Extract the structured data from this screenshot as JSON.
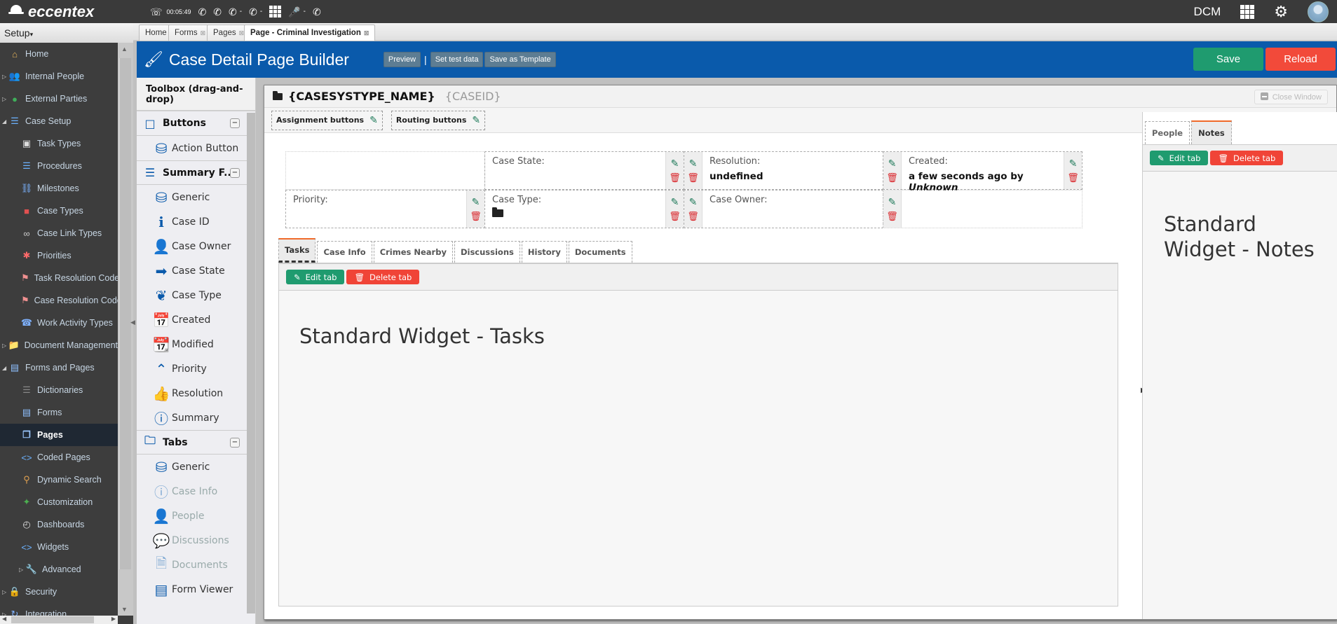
{
  "topbar": {
    "brand": "eccentex",
    "call_timer": "00:05:49",
    "icons": [
      "phone-icon",
      "phone-hangup-icon",
      "phone-hold-icon",
      "phone-transfer-icon",
      "phone-forward-icon",
      "dialpad-icon",
      "microphone-icon",
      "phone-info-icon"
    ],
    "user_label": "DCM"
  },
  "nav": {
    "setup_label": "Setup",
    "items": [
      {
        "label": "Home",
        "level": 1,
        "icon": "home-icon",
        "expand": ""
      },
      {
        "label": "Internal People",
        "level": 1,
        "icon": "people-icon",
        "expand": "collapsed"
      },
      {
        "label": "External Parties",
        "level": 1,
        "icon": "globe-icon",
        "expand": "collapsed"
      },
      {
        "label": "Case Setup",
        "level": 1,
        "icon": "list-icon",
        "expand": "expanded"
      },
      {
        "label": "Task Types",
        "level": 2,
        "icon": "cube-icon"
      },
      {
        "label": "Procedures",
        "level": 2,
        "icon": "list-icon"
      },
      {
        "label": "Milestones",
        "level": 2,
        "icon": "milestone-icon"
      },
      {
        "label": "Case Types",
        "level": 2,
        "icon": "cubes-icon"
      },
      {
        "label": "Case Link Types",
        "level": 2,
        "icon": "link-icon"
      },
      {
        "label": "Priorities",
        "level": 2,
        "icon": "asterisk-icon"
      },
      {
        "label": "Task Resolution Codes",
        "level": 2,
        "icon": "tag-icon"
      },
      {
        "label": "Case Resolution Codes",
        "level": 2,
        "icon": "tag-icon"
      },
      {
        "label": "Work Activity Types",
        "level": 2,
        "icon": "telephone-icon"
      },
      {
        "label": "Document Management",
        "level": 1,
        "icon": "folder-icon",
        "expand": "collapsed"
      },
      {
        "label": "Forms and Pages",
        "level": 1,
        "icon": "form-icon",
        "expand": "expanded"
      },
      {
        "label": "Dictionaries",
        "level": 2,
        "icon": "dictionary-icon"
      },
      {
        "label": "Forms",
        "level": 2,
        "icon": "form-icon"
      },
      {
        "label": "Pages",
        "level": 2,
        "icon": "pages-icon",
        "active": true
      },
      {
        "label": "Coded Pages",
        "level": 2,
        "icon": "code-icon"
      },
      {
        "label": "Dynamic Search",
        "level": 2,
        "icon": "search-icon"
      },
      {
        "label": "Customization",
        "level": 2,
        "icon": "puzzle-icon"
      },
      {
        "label": "Dashboards",
        "level": 2,
        "icon": "dashboard-icon"
      },
      {
        "label": "Widgets",
        "level": 2,
        "icon": "code-icon"
      },
      {
        "label": "Advanced",
        "level": 3,
        "icon": "wrench-icon",
        "expand": "collapsed"
      },
      {
        "label": "Security",
        "level": 1,
        "icon": "lock-icon",
        "expand": "collapsed"
      },
      {
        "label": "Integration",
        "level": 1,
        "icon": "integration-icon",
        "expand": "collapsed"
      }
    ]
  },
  "tabs": [
    {
      "label": "Home",
      "closable": false
    },
    {
      "label": "Forms",
      "closable": true
    },
    {
      "label": "Pages",
      "closable": true
    },
    {
      "label": "Page - Criminal Investigation",
      "closable": true,
      "active": true
    }
  ],
  "header": {
    "title": "Case Detail Page Builder",
    "preview": "Preview",
    "separator": "|",
    "set_test_data": "Set test data",
    "save_as_template": "Save as Template",
    "save": "Save",
    "reload": "Reload"
  },
  "toolbox": {
    "title": "Toolbox (drag-and-drop)",
    "sections": [
      {
        "label": "Buttons",
        "icon": "square-icon",
        "items": [
          {
            "label": "Action Button",
            "icon": "database-icon"
          }
        ]
      },
      {
        "label": "Summary F...",
        "icon": "menu-icon",
        "items": [
          {
            "label": "Generic",
            "icon": "database-icon"
          },
          {
            "label": "Case ID",
            "icon": "info-icon"
          },
          {
            "label": "Case Owner",
            "icon": "user-icon"
          },
          {
            "label": "Case State",
            "icon": "arrow-circle-icon"
          },
          {
            "label": "Case Type",
            "icon": "leaf-icon"
          },
          {
            "label": "Created",
            "icon": "calendar-icon"
          },
          {
            "label": "Modified",
            "icon": "calendar-check-icon"
          },
          {
            "label": "Priority",
            "icon": "double-chevron-up-icon"
          },
          {
            "label": "Resolution",
            "icon": "thumbs-up-icon"
          },
          {
            "label": "Summary",
            "icon": "info-circle-icon"
          }
        ]
      },
      {
        "label": "Tabs",
        "icon": "folder-icon",
        "items": [
          {
            "label": "Generic",
            "icon": "database-icon"
          },
          {
            "label": "Case Info",
            "icon": "info-circle-icon",
            "disabled": true
          },
          {
            "label": "People",
            "icon": "user-icon",
            "disabled": true
          },
          {
            "label": "Discussions",
            "icon": "chat-icon",
            "disabled": true
          },
          {
            "label": "Documents",
            "icon": "document-icon",
            "disabled": true
          },
          {
            "label": "Form Viewer",
            "icon": "list-icon"
          }
        ]
      }
    ]
  },
  "canvas": {
    "title": "{CASESYSTYPE_NAME}",
    "case_id": "{CASEID}",
    "close_window": "Close Window",
    "assignment_buttons": "Assignment buttons",
    "routing_buttons": "Routing buttons",
    "summary_rows": [
      [
        {
          "label": "",
          "value": "",
          "empty": true
        },
        {
          "label": "Case State:",
          "value": ""
        },
        {
          "label": "Resolution:",
          "value": "undefined"
        },
        {
          "label": "Created:",
          "value": "a few seconds ago by",
          "value_em": "Unknown"
        }
      ],
      [
        {
          "label": "Priority:",
          "value": ""
        },
        {
          "label": "Case Type:",
          "value": "",
          "folder": true
        },
        {
          "label": "Case Owner:",
          "value": ""
        },
        {
          "label": "",
          "value": "",
          "empty": true
        }
      ]
    ],
    "content_tabs": [
      "Tasks",
      "Case Info",
      "Crimes Nearby",
      "Discussions",
      "History",
      "Documents"
    ],
    "active_content_tab": "Tasks",
    "edit_tab": "Edit tab",
    "delete_tab": "Delete tab",
    "widget_title": "Standard Widget - Tasks"
  },
  "right_pane": {
    "tabs": [
      "People",
      "Notes"
    ],
    "active_tab": "Notes",
    "edit_tab": "Edit tab",
    "delete_tab": "Delete tab",
    "widget_line1": "Standard",
    "widget_line2": "Widget - Notes"
  },
  "colors": {
    "header_blue": "#0a5aab",
    "save_green": "#1f9b6f",
    "reload_red": "#f24a3a",
    "active_tab_accent": "#f06a2a"
  }
}
